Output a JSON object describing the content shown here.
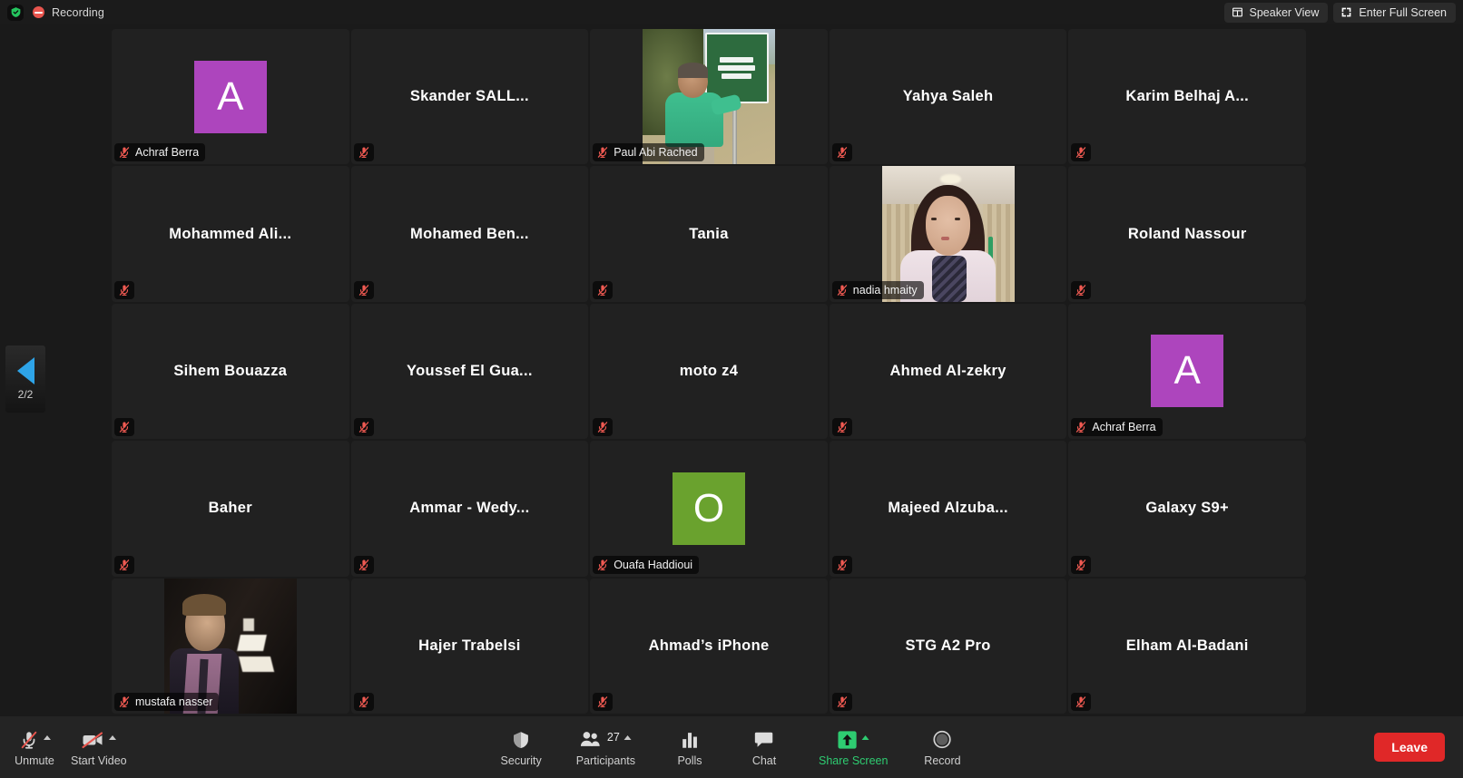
{
  "topbar": {
    "encryption_icon": "shield-check-icon",
    "recording_label": "Recording",
    "speaker_view_label": "Speaker View",
    "speaker_view_icon": "layout-icon",
    "fullscreen_label": "Enter Full Screen",
    "fullscreen_icon": "expand-icon"
  },
  "page_nav": {
    "direction_icon": "chevron-left-icon",
    "page_indicator": "2/2",
    "accent_color": "#2ea4e8"
  },
  "colors": {
    "avatar_purple": "#ad45bd",
    "avatar_green": "#6aa22e",
    "muted_red": "#e8554e",
    "leave_red": "#e02828",
    "share_green": "#2ecc71",
    "tile_bg": "#212121",
    "app_bg": "#1a1a1a"
  },
  "gallery": {
    "columns": 5,
    "rows": 5,
    "tiles": [
      {
        "display_name": "Achraf Berra",
        "badge_name": "Achraf Berra",
        "content": "avatar",
        "avatar_letter": "A",
        "avatar_color": "#ad45bd",
        "muted": true
      },
      {
        "display_name": "Skander SALL...",
        "badge_name": "",
        "content": "name",
        "muted": true
      },
      {
        "display_name": "Paul Abi Rached",
        "badge_name": "Paul Abi Rached",
        "content": "video",
        "video": "paul",
        "muted": true
      },
      {
        "display_name": "Yahya Saleh",
        "badge_name": "",
        "content": "name",
        "muted": true
      },
      {
        "display_name": "Karim Belhaj A...",
        "badge_name": "",
        "content": "name",
        "muted": true
      },
      {
        "display_name": "Mohammed Ali...",
        "badge_name": "",
        "content": "name",
        "muted": true
      },
      {
        "display_name": "Mohamed Ben...",
        "badge_name": "",
        "content": "name",
        "muted": true
      },
      {
        "display_name": "Tania",
        "badge_name": "",
        "content": "name",
        "muted": true
      },
      {
        "display_name": "nadia hmaity",
        "badge_name": "nadia hmaity",
        "content": "video",
        "video": "nadia",
        "muted": true
      },
      {
        "display_name": "Roland Nassour",
        "badge_name": "",
        "content": "name",
        "muted": true
      },
      {
        "display_name": "Sihem Bouazza",
        "badge_name": "",
        "content": "name",
        "muted": true
      },
      {
        "display_name": "Youssef El Gua...",
        "badge_name": "",
        "content": "name",
        "muted": true
      },
      {
        "display_name": "moto z4",
        "badge_name": "",
        "content": "name",
        "muted": true
      },
      {
        "display_name": "Ahmed Al-zekry",
        "badge_name": "",
        "content": "name",
        "muted": true
      },
      {
        "display_name": "Achraf Berra",
        "badge_name": "Achraf Berra",
        "content": "avatar",
        "avatar_letter": "A",
        "avatar_color": "#ad45bd",
        "muted": true
      },
      {
        "display_name": "Baher",
        "badge_name": "",
        "content": "name",
        "muted": true
      },
      {
        "display_name": "Ammar - Wedy...",
        "badge_name": "",
        "content": "name",
        "muted": true
      },
      {
        "display_name": "Ouafa Haddioui",
        "badge_name": "Ouafa Haddioui",
        "content": "avatar",
        "avatar_letter": "O",
        "avatar_color": "#6aa22e",
        "muted": true
      },
      {
        "display_name": "Majeed Alzuba...",
        "badge_name": "",
        "content": "name",
        "muted": true
      },
      {
        "display_name": "Galaxy S9+",
        "badge_name": "",
        "content": "name",
        "muted": true
      },
      {
        "display_name": "mustafa nasser",
        "badge_name": "mustafa nasser",
        "content": "video",
        "video": "mustafa",
        "muted": true
      },
      {
        "display_name": "Hajer Trabelsi",
        "badge_name": "",
        "content": "name",
        "muted": true
      },
      {
        "display_name": "Ahmad’s iPhone",
        "badge_name": "",
        "content": "name",
        "muted": true
      },
      {
        "display_name": "STG A2 Pro",
        "badge_name": "",
        "content": "name",
        "muted": true
      },
      {
        "display_name": "Elham Al-Badani",
        "badge_name": "",
        "content": "name",
        "muted": true
      }
    ]
  },
  "toolbar": {
    "unmute_label": "Unmute",
    "unmute_icon": "mic-muted-icon",
    "start_video_label": "Start Video",
    "start_video_icon": "video-muted-icon",
    "security_label": "Security",
    "security_icon": "shield-icon",
    "participants_label": "Participants",
    "participants_icon": "people-icon",
    "participants_count": "27",
    "polls_label": "Polls",
    "polls_icon": "bar-chart-icon",
    "chat_label": "Chat",
    "chat_icon": "speech-bubble-icon",
    "share_screen_label": "Share Screen",
    "share_screen_icon": "upload-arrow-icon",
    "record_label": "Record",
    "record_icon": "record-circle-icon",
    "leave_label": "Leave"
  }
}
